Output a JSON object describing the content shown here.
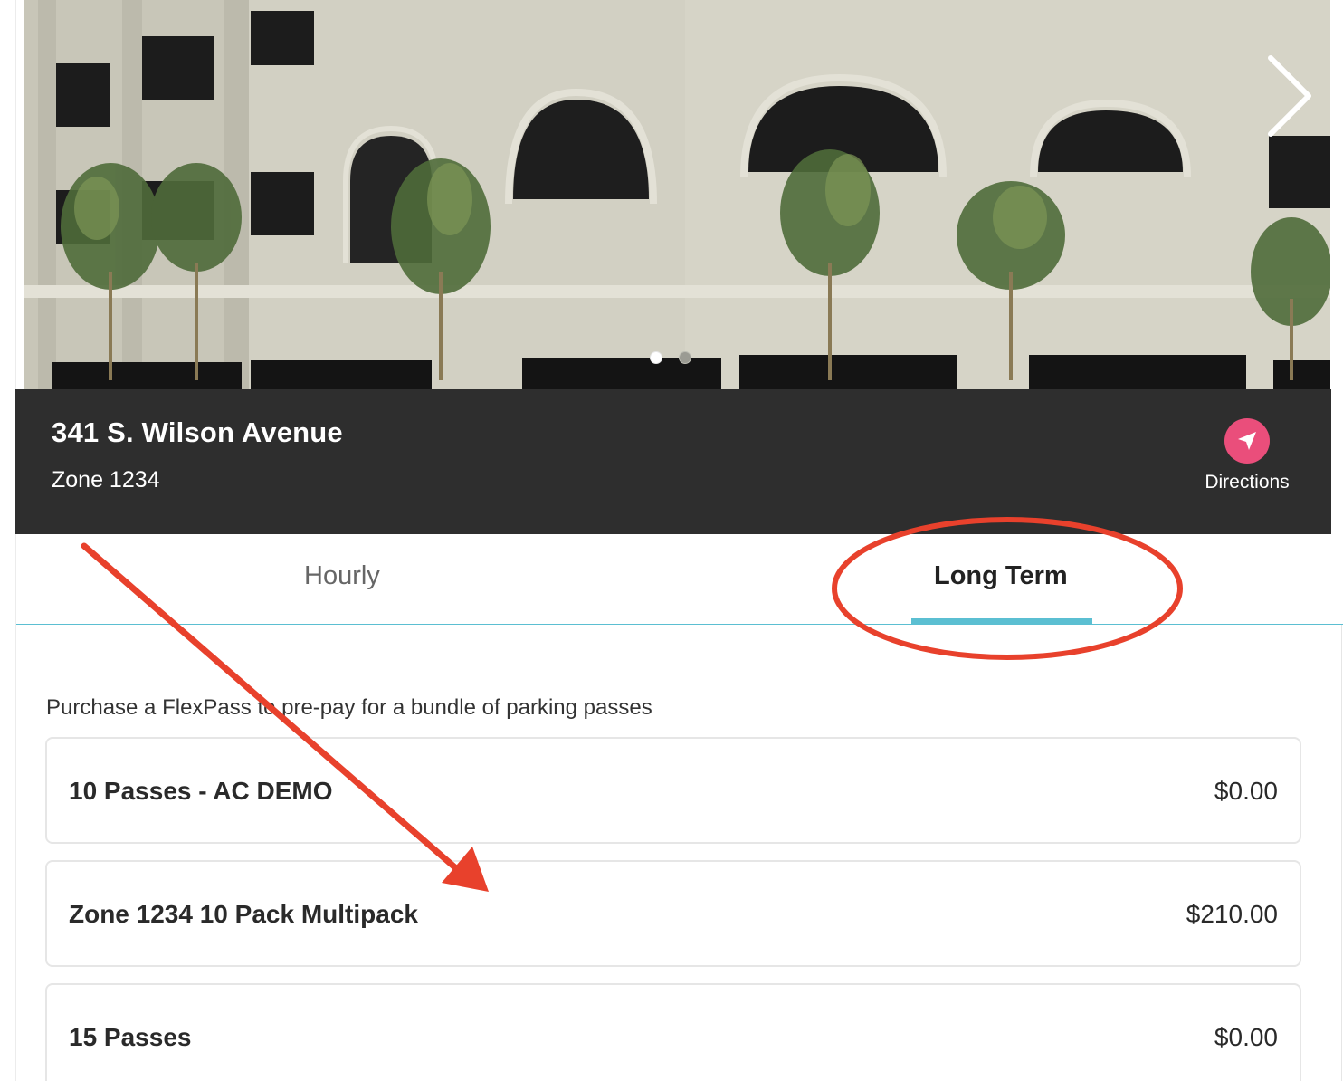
{
  "location": {
    "address": "341 S. Wilson Avenue",
    "zone": "Zone 1234",
    "directions_label": "Directions",
    "directions_icon": "navigation-arrow-icon",
    "directions_color": "#ea4e7b"
  },
  "carousel": {
    "next_icon": "chevron-right-icon",
    "slide_count": 2,
    "active_slide": 1
  },
  "tabs": [
    {
      "label": "Hourly",
      "selected": false
    },
    {
      "label": "Long Term",
      "selected": true
    }
  ],
  "tab_accent_color": "#5bbfd2",
  "intro_text": "Purchase a FlexPass to pre-pay for a bundle of parking passes",
  "passes": [
    {
      "name": "10 Passes - AC DEMO",
      "price": "$0.00"
    },
    {
      "name": "Zone 1234 10 Pack Multipack",
      "price": "$210.00"
    },
    {
      "name": "15 Passes",
      "price": "$0.00"
    }
  ],
  "annotation_color": "#e8412c"
}
